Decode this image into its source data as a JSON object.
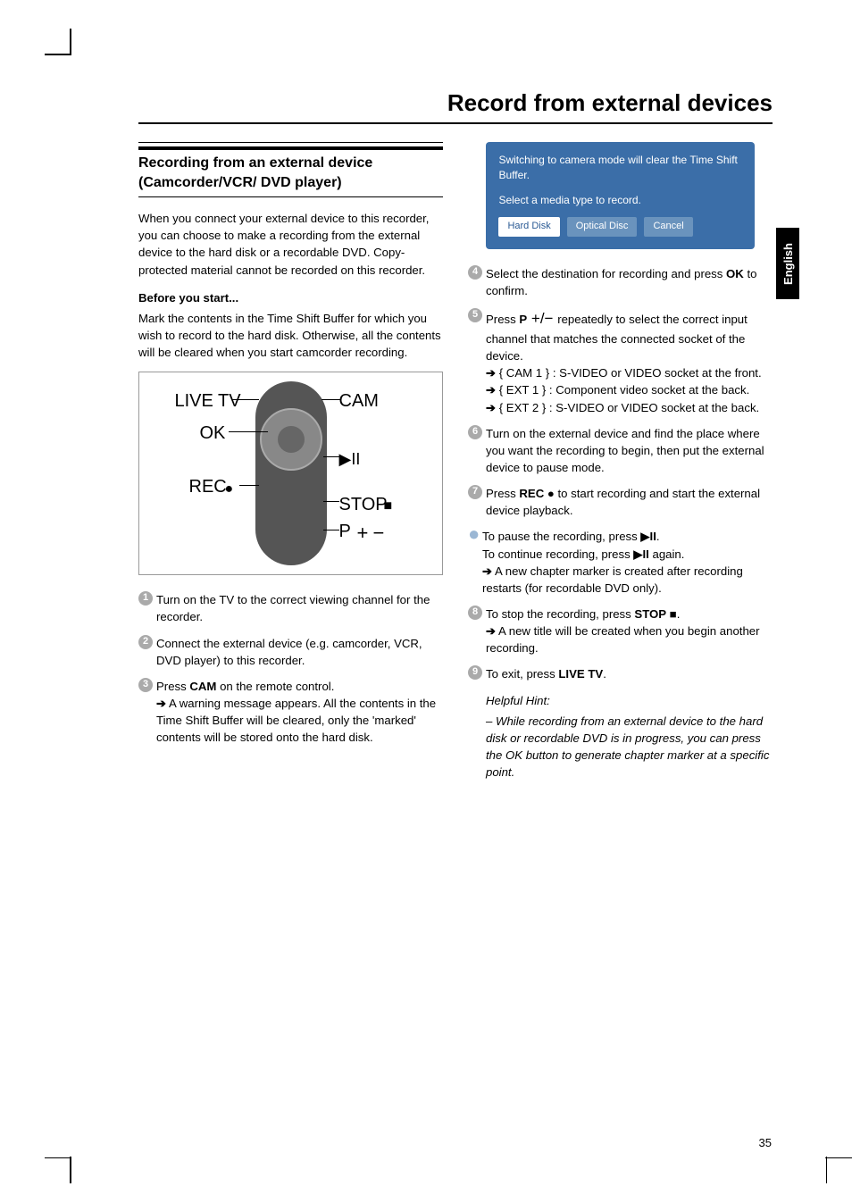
{
  "page": {
    "title": "Record from external devices",
    "lang_tab": "English",
    "page_number": "35"
  },
  "left": {
    "heading": "Recording from an external device (Camcorder/VCR/ DVD player)",
    "intro": "When you connect your external device to this recorder, you can choose to make a recording from the external device to the hard disk or a recordable DVD. Copy-protected material cannot be recorded on this recorder.",
    "before_label": "Before you start...",
    "before_text": "Mark the contents in the Time Shift Buffer for which you wish to record to the hard disk. Otherwise, all the contents will be cleared when you start camcorder recording.",
    "remote_labels": {
      "live_tv": "LIVE TV",
      "ok": "OK",
      "rec": "REC",
      "cam": "CAM",
      "play_pause": "▶II",
      "stop": "STOP",
      "p_plus_minus": "P",
      "rec_dot": "●",
      "stop_sq": "■",
      "plus": "+",
      "minus": "−"
    },
    "step1": "Turn on the TV to the correct viewing channel for the recorder.",
    "step2": "Connect the external device (e.g. camcorder, VCR, DVD player) to this recorder.",
    "step3_a": "Press ",
    "step3_cam": "CAM",
    "step3_b": " on the remote control.",
    "step3_sub": " A warning message appears. All the contents in the Time Shift Buffer will be cleared, only the 'marked' contents will be stored onto the hard disk."
  },
  "right": {
    "dialog": {
      "line1": "Switching to camera mode will clear the Time Shift Buffer.",
      "line2": "Select a media type to record.",
      "btn_hard_disk": "Hard Disk",
      "btn_optical": "Optical Disc",
      "btn_cancel": "Cancel"
    },
    "step4_a": "Select the destination for recording and press ",
    "step4_ok": "OK",
    "step4_b": " to confirm.",
    "step5_a": "Press ",
    "step5_p": "P",
    "step5_pm": " +/− ",
    "step5_b": " repeatedly to select the correct input channel that matches the connected socket of the device.",
    "step5_cam1": " { CAM 1 } : S-VIDEO or VIDEO socket at the front.",
    "step5_ext1": " { EXT 1 } : Component video socket at the back.",
    "step5_ext2": " { EXT 2 } : S-VIDEO or VIDEO socket at the back.",
    "step6": "Turn on the external device and find the place where you want the recording to begin, then put the external device to pause mode.",
    "step7_a": "Press ",
    "step7_rec": "REC",
    "step7_dot": " ● ",
    "step7_b": "to start recording and start the external device playback.",
    "bullet_a": "To pause the recording, press ",
    "bullet_pp": "▶II",
    "bullet_b": ".",
    "bullet_c": "To continue recording, press ",
    "bullet_pp2": "▶II",
    "bullet_d": " again.",
    "bullet_sub": " A new chapter marker is created after recording restarts (for recordable DVD only).",
    "step8_a": "To stop the recording, press ",
    "step8_stop": "STOP",
    "step8_sq": " ■",
    "step8_dot": ".",
    "step8_sub": " A new title will be created when you begin another recording.",
    "step9_a": "To exit, press ",
    "step9_live": "LIVE TV",
    "step9_b": ".",
    "hint_label": "Helpful Hint:",
    "hint_text": "– While recording from an external device to the hard disk or recordable DVD is in progress, you can press the OK button to generate chapter marker at a specific point."
  }
}
